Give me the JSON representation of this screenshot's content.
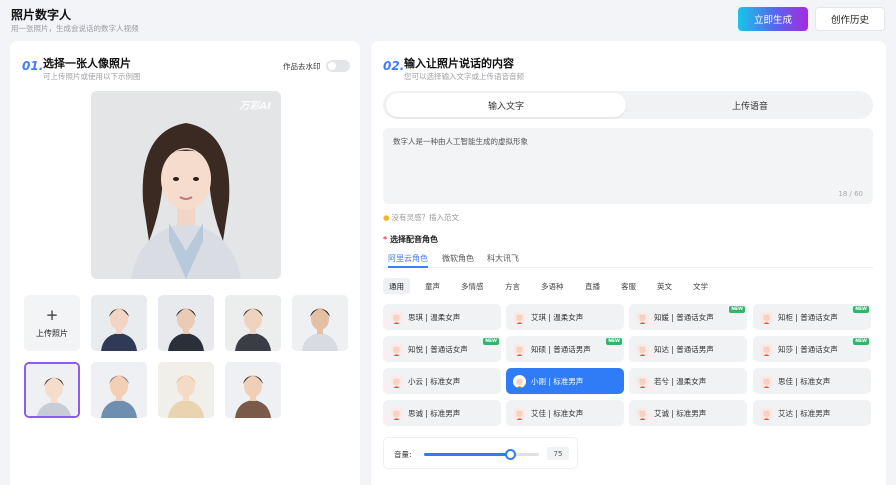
{
  "header": {
    "title": "照片数字人",
    "subtitle": "用一张照片，生成会说话的数字人视频",
    "generate_label": "立即生成",
    "history_label": "创作历史"
  },
  "left": {
    "num": "01.",
    "title": "选择一张人像照片",
    "subtitle": "可上传照片或使用以下示例图",
    "watermark_label": "作品去水印",
    "watermark_on": false,
    "photo_watermark": "万彩AI",
    "upload_label": "上传照片",
    "selected_thumb_index": 5
  },
  "right": {
    "num": "02.",
    "title": "输入让照片说话的内容",
    "subtitle": "您可以选择输入文字或上传语音音频",
    "tabs": [
      "输入文字",
      "上传语音"
    ],
    "active_tab": 0,
    "text_value": "数字人是一种由人工智能生成的虚拟形象",
    "counter": "18 / 60",
    "hint": "没有灵感？插入范文",
    "voice_title": "选择配音角色",
    "voice_tabs": [
      "阿里云角色",
      "微软角色",
      "科大讯飞"
    ],
    "categories": [
      "通用",
      "童声",
      "多情感",
      "方言",
      "多语种",
      "直播",
      "客服",
      "英文",
      "文学"
    ],
    "voices": [
      {
        "label": "思琪 | 温柔女声",
        "gender": "female",
        "new": false
      },
      {
        "label": "艾琪 | 温柔女声",
        "gender": "female",
        "new": false
      },
      {
        "label": "知媛 | 普通话女声",
        "gender": "female",
        "new": true
      },
      {
        "label": "知柜 | 普通话女声",
        "gender": "female",
        "new": true
      },
      {
        "label": "知悦 | 普通话女声",
        "gender": "female",
        "new": true
      },
      {
        "label": "知硕 | 普通话男声",
        "gender": "male",
        "new": true
      },
      {
        "label": "知达 | 普通话男声",
        "gender": "male",
        "new": false
      },
      {
        "label": "知莎 | 普通话女声",
        "gender": "female",
        "new": true
      },
      {
        "label": "小云 | 标准女声",
        "gender": "female",
        "new": false
      },
      {
        "label": "小刚 | 标准男声",
        "gender": "male",
        "new": false,
        "selected": true
      },
      {
        "label": "若兮 | 温柔女声",
        "gender": "female",
        "new": false
      },
      {
        "label": "思佳 | 标准女声",
        "gender": "female",
        "new": false
      },
      {
        "label": "思诚 | 标准男声",
        "gender": "male",
        "new": false
      },
      {
        "label": "艾佳 | 标准女声",
        "gender": "female",
        "new": false
      },
      {
        "label": "艾诚 | 标准男声",
        "gender": "male",
        "new": false
      },
      {
        "label": "艾达 | 标准男声",
        "gender": "male",
        "new": false
      }
    ],
    "new_badge": "NEW",
    "volume_label": "音量:",
    "volume_value": "75",
    "volume_fraction": 0.75
  },
  "colors": {
    "accent": "#2f7cf6",
    "new": "#36b36b"
  }
}
